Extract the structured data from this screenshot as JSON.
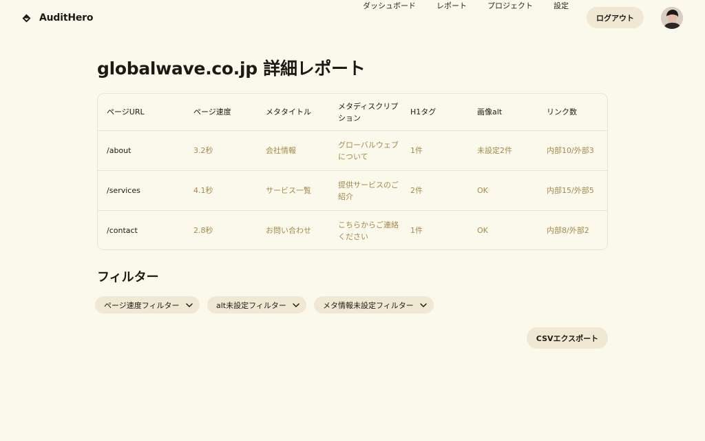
{
  "app": {
    "name": "AuditHero"
  },
  "nav": {
    "items": [
      "ダッシュボード",
      "レポート",
      "プロジェクト",
      "設定"
    ],
    "logout": "ログアウト"
  },
  "page": {
    "title": "globalwave.co.jp 詳細レポート"
  },
  "table": {
    "headers": [
      "ページURL",
      "ページ速度",
      "メタタイトル",
      "メタディスクリプション",
      "H1タグ",
      "画像alt",
      "リンク数"
    ],
    "rows": [
      [
        "/about",
        "3.2秒",
        "会社情報",
        "グローバルウェブについて",
        "1件",
        "未設定2件",
        "内部10/外部3"
      ],
      [
        "/services",
        "4.1秒",
        "サービス一覧",
        "提供サービスのご紹介",
        "2件",
        "OK",
        "内部15/外部5"
      ],
      [
        "/contact",
        "2.8秒",
        "お問い合わせ",
        "こちらからご連絡ください",
        "1件",
        "OK",
        "内部8/外部2"
      ]
    ]
  },
  "filters": {
    "title": "フィルター",
    "chips": [
      "ページ速度フィルター",
      "alt未設定フィルター",
      "メタ情報未設定フィルター"
    ]
  },
  "export": {
    "label": "CSVエクスポート"
  },
  "colors": {
    "background": "#fbf8ec",
    "accent_text": "#a38a49",
    "chip": "#f1e8d4"
  }
}
